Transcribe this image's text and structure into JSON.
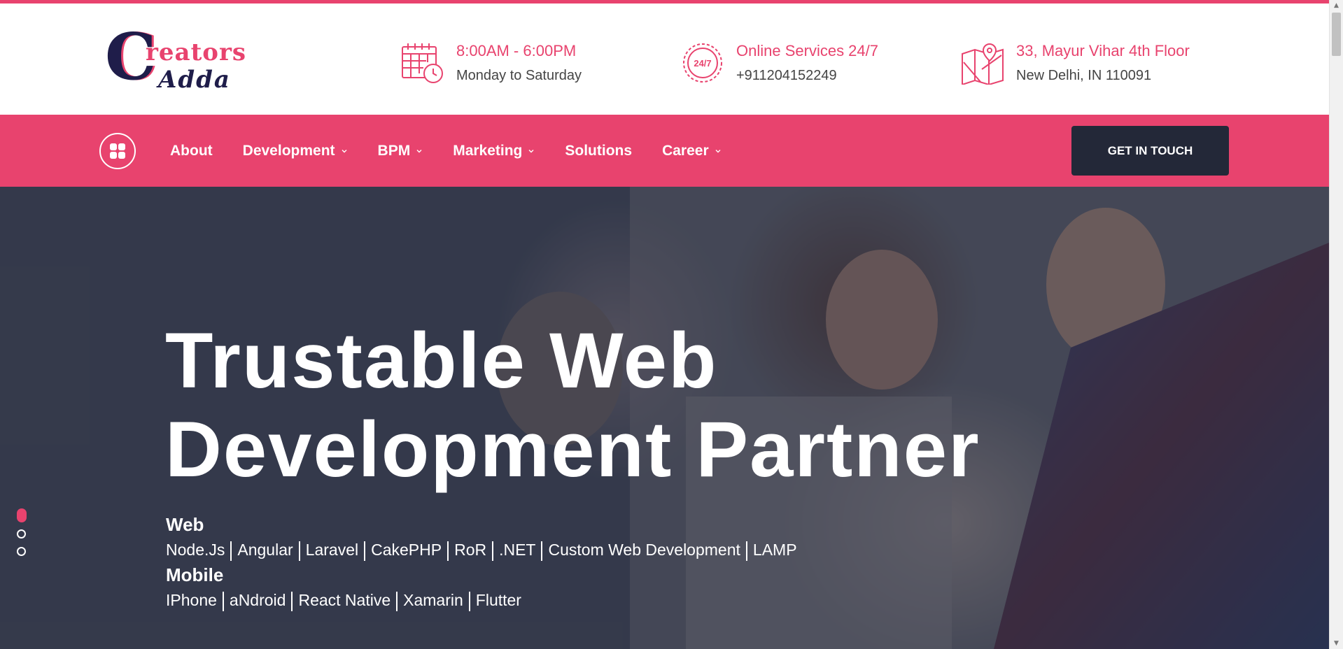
{
  "brand": {
    "logo_word1": "reators",
    "logo_word2": "Adda",
    "logo_initial": "C",
    "accent_color": "#e8436e",
    "dark_color": "#232838"
  },
  "info": {
    "hours": {
      "title": "8:00AM - 6:00PM",
      "subtitle": "Monday to Saturday",
      "icon": "calendar-clock-icon"
    },
    "support": {
      "title": "Online Services 24/7",
      "subtitle": "+911204152249",
      "icon": "24-7-support-icon",
      "badge": "24/7"
    },
    "address": {
      "title": "33, Mayur Vihar 4th Floor",
      "subtitle": "New Delhi, IN 110091",
      "icon": "map-pin-icon"
    }
  },
  "nav": {
    "items": [
      {
        "label": "About",
        "has_dropdown": false
      },
      {
        "label": "Development",
        "has_dropdown": true
      },
      {
        "label": "BPM",
        "has_dropdown": true
      },
      {
        "label": "Marketing",
        "has_dropdown": true
      },
      {
        "label": "Solutions",
        "has_dropdown": false
      },
      {
        "label": "Career",
        "has_dropdown": true
      }
    ],
    "cta_label": "GET IN TOUCH"
  },
  "hero": {
    "title_line1": "Trustable Web",
    "title_line2": "Development Partner",
    "groups": [
      {
        "title": "Web",
        "items": [
          "Node.Js",
          "Angular",
          "Laravel",
          "CakePHP",
          "RoR",
          ".NET",
          "Custom Web Development",
          "LAMP"
        ]
      },
      {
        "title": "Mobile",
        "items": [
          "IPhone",
          "aNdroid",
          "React Native",
          "Xamarin",
          "Flutter"
        ]
      }
    ],
    "slides_total": 3,
    "active_slide": 1
  }
}
